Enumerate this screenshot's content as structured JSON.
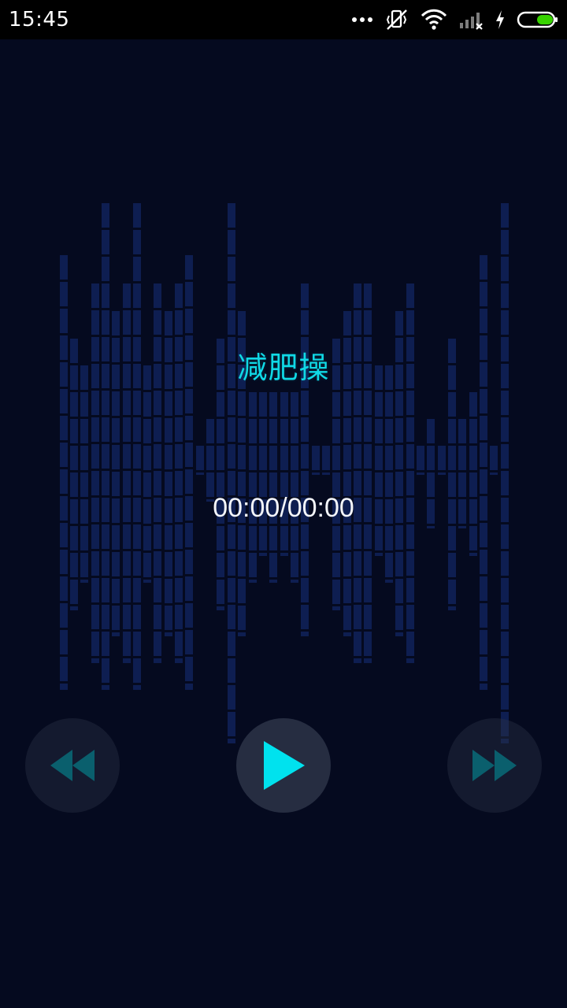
{
  "status_bar": {
    "time": "15:45",
    "icons": [
      "more-dots-icon",
      "mute-vibrate-icon",
      "wifi-icon",
      "signal-icon",
      "charging-icon",
      "battery-icon"
    ]
  },
  "player": {
    "title": "减肥操",
    "time_text": "00:00/00:00"
  },
  "controls": [
    {
      "name": "rewind",
      "icon": "rewind-icon"
    },
    {
      "name": "play",
      "icon": "play-icon"
    },
    {
      "name": "fast-forward",
      "icon": "fast-forward-icon"
    }
  ],
  "colors": {
    "background": "#050a1f",
    "accent": "#10d9e6",
    "equalizer": "#0f2158",
    "status_bar": "#000000"
  }
}
